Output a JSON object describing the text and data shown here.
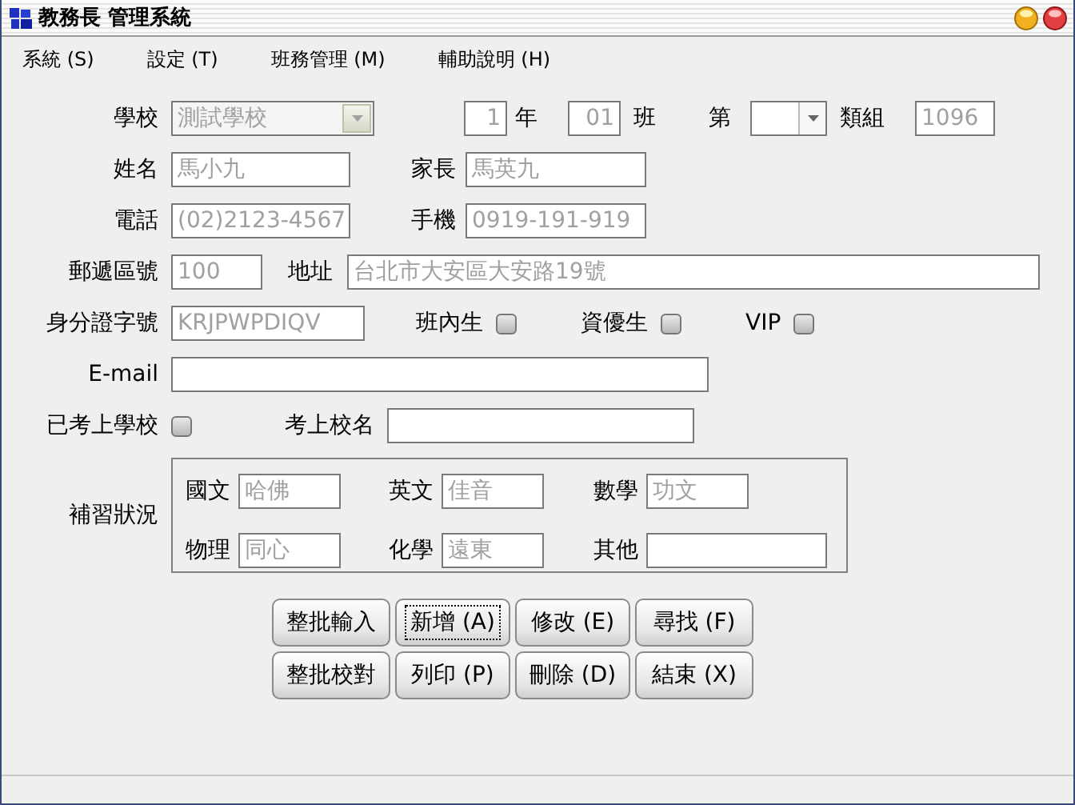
{
  "window": {
    "title": "教務長 管理系統"
  },
  "menu": [
    {
      "label": "系統 (S)"
    },
    {
      "label": "設定 (T)"
    },
    {
      "label": "班務管理 (M)"
    },
    {
      "label": "輔助說明 (H)"
    }
  ],
  "form": {
    "school": {
      "label": "學校",
      "value": "測試學校",
      "disabled": true
    },
    "grade": {
      "value": "1",
      "label": "年"
    },
    "class": {
      "value": "01",
      "label": "班"
    },
    "order": {
      "label": "第",
      "disabled": false
    },
    "group": {
      "label": "類組",
      "value": "1096"
    },
    "name": {
      "label": "姓名",
      "value": "馬小九"
    },
    "parent": {
      "label": "家長",
      "value": "馬英九"
    },
    "phone": {
      "label": "電話",
      "value": "(02)2123-4567"
    },
    "mobile": {
      "label": "手機",
      "value": "0919-191-919"
    },
    "zip": {
      "label": "郵遞區號",
      "value": "100"
    },
    "address": {
      "label": "地址",
      "value": "台北市大安區大安路19號"
    },
    "id": {
      "label": "身分證字號",
      "value": "KRJPWPDIQV"
    },
    "flags": [
      {
        "label": "班內生",
        "checked": false
      },
      {
        "label": "資優生",
        "checked": false
      },
      {
        "label": "VIP",
        "checked": false
      }
    ],
    "email": {
      "label": "E-mail"
    },
    "admitted": {
      "label": "已考上學校",
      "checked": false
    },
    "admitted_school": {
      "label": "考上校名"
    },
    "tutoring": {
      "label": "補習狀況",
      "subjects": [
        {
          "label": "國文",
          "value": "哈佛"
        },
        {
          "label": "英文",
          "value": "佳音"
        },
        {
          "label": "數學",
          "value": "功文"
        },
        {
          "label": "物理",
          "value": "同心"
        },
        {
          "label": "化學",
          "value": "遠東"
        },
        {
          "label": "其他"
        }
      ]
    }
  },
  "buttons": [
    {
      "label": "整批輸入",
      "focused": false
    },
    {
      "label": "新增 (A)",
      "focused": true
    },
    {
      "label": "修改 (E)",
      "focused": false
    },
    {
      "label": "尋找 (F)",
      "focused": false
    },
    {
      "label": "整批校對",
      "focused": false
    },
    {
      "label": "列印 (P)",
      "focused": false
    },
    {
      "label": "刪除 (D)",
      "focused": false
    },
    {
      "label": "結束 (X)",
      "focused": false
    }
  ]
}
